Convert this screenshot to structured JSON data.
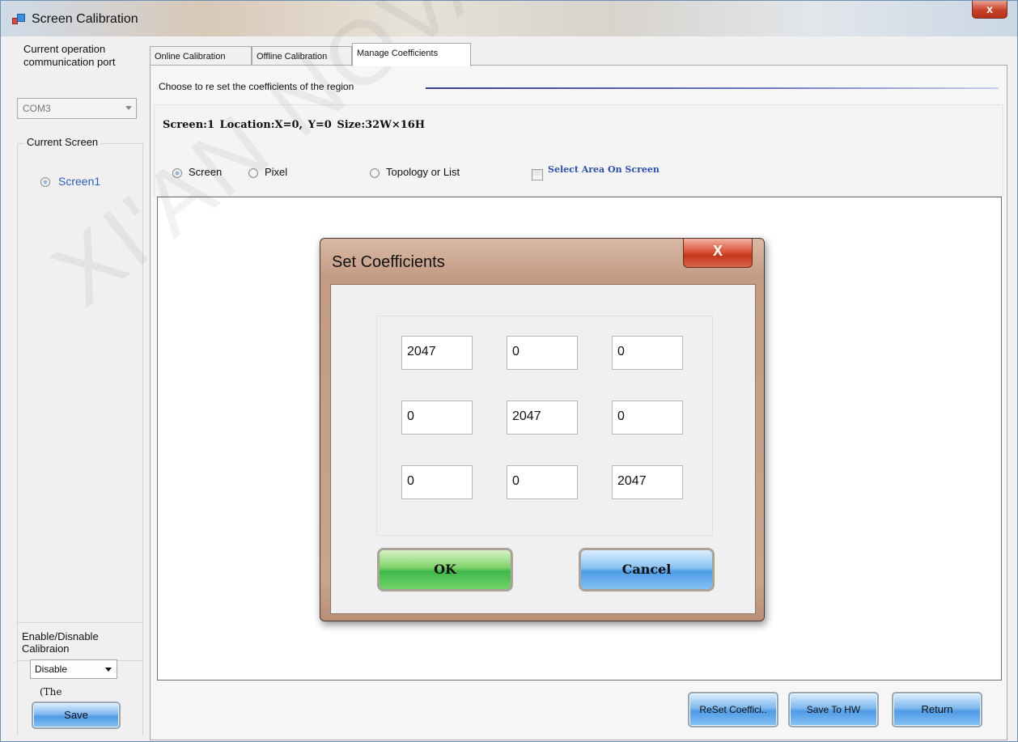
{
  "window": {
    "title": "Screen Calibration",
    "close_glyph": "x"
  },
  "left": {
    "port_label": "Current operation communication port",
    "port_value": "COM3",
    "screen_group_label": "Current Screen",
    "screen_item": "Screen1",
    "enable_label": "Enable/Disnable Calibraion",
    "enable_value": "Disable",
    "note": "(The",
    "save_label": "Save"
  },
  "tabs": [
    {
      "label": "Online Calibration"
    },
    {
      "label": "Offline Calibration"
    },
    {
      "label": "Manage Coefficients"
    }
  ],
  "panel": {
    "choose_text": "Choose to re set the coefficients of the region",
    "info_text": "Screen:1  Location:X=0, Y=0   Size:32W×16H",
    "options": {
      "screen": "Screen",
      "pixel": "Pixel",
      "topology": "Topology or List",
      "select_area": "Select Area On Screen"
    },
    "buttons": {
      "reset": "ReSet Coeffici..",
      "save_hw": "Save To HW",
      "return": "Return"
    }
  },
  "dialog": {
    "title": "Set Coefficients",
    "close_glyph": "X",
    "matrix": [
      [
        "2047",
        "0",
        "0"
      ],
      [
        "0",
        "2047",
        "0"
      ],
      [
        "0",
        "0",
        "2047"
      ]
    ],
    "ok_label": "OK",
    "cancel_label": "Cancel"
  },
  "watermark": "XI'AN NOVASTAR TECH",
  "colors": {
    "accent_blue": "#4f9be6",
    "ok_green": "#3fb84a",
    "close_red": "#c8412a"
  }
}
